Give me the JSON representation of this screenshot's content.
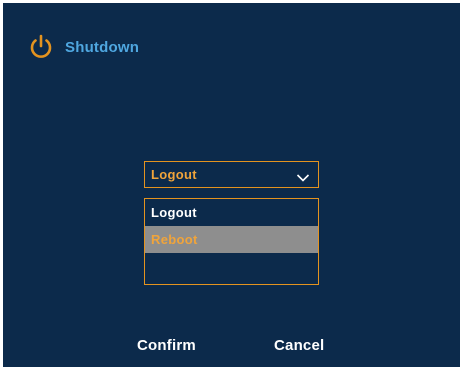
{
  "dialog": {
    "title": "Shutdown",
    "icon": "power-icon",
    "accent_color": "#e4931f",
    "title_color": "#4fa7e0",
    "background_color": "#0c2a4b"
  },
  "select": {
    "value": "Logout",
    "icon": "chevron-down-icon",
    "options": [
      {
        "label": "Logout",
        "highlighted": false
      },
      {
        "label": "Reboot",
        "highlighted": true
      }
    ]
  },
  "buttons": {
    "confirm_label": "Confirm",
    "cancel_label": "Cancel"
  }
}
